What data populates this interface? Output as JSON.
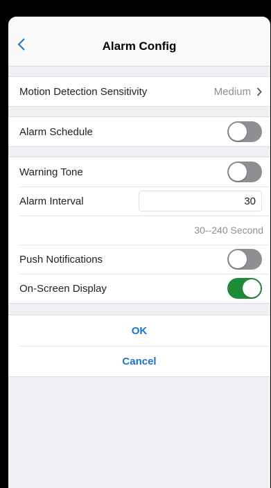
{
  "header": {
    "title": "Alarm Config",
    "back_icon": "chevron-left-icon"
  },
  "sensitivity": {
    "label": "Motion Detection Sensitivity",
    "value": "Medium"
  },
  "schedule": {
    "label": "Alarm Schedule",
    "enabled": false
  },
  "warning_tone": {
    "label": "Warning Tone",
    "enabled": false
  },
  "alarm_interval": {
    "label": "Alarm Interval",
    "value": "30",
    "hint": "30--240 Second"
  },
  "push_notifications": {
    "label": "Push Notifications",
    "enabled": false
  },
  "osd": {
    "label": "On-Screen Display",
    "enabled": true
  },
  "actions": {
    "ok": "OK",
    "cancel": "Cancel"
  },
  "colors": {
    "accent": "#1a73c8",
    "toggle_on": "#1f8a3a",
    "toggle_off": "#8e8e93"
  }
}
